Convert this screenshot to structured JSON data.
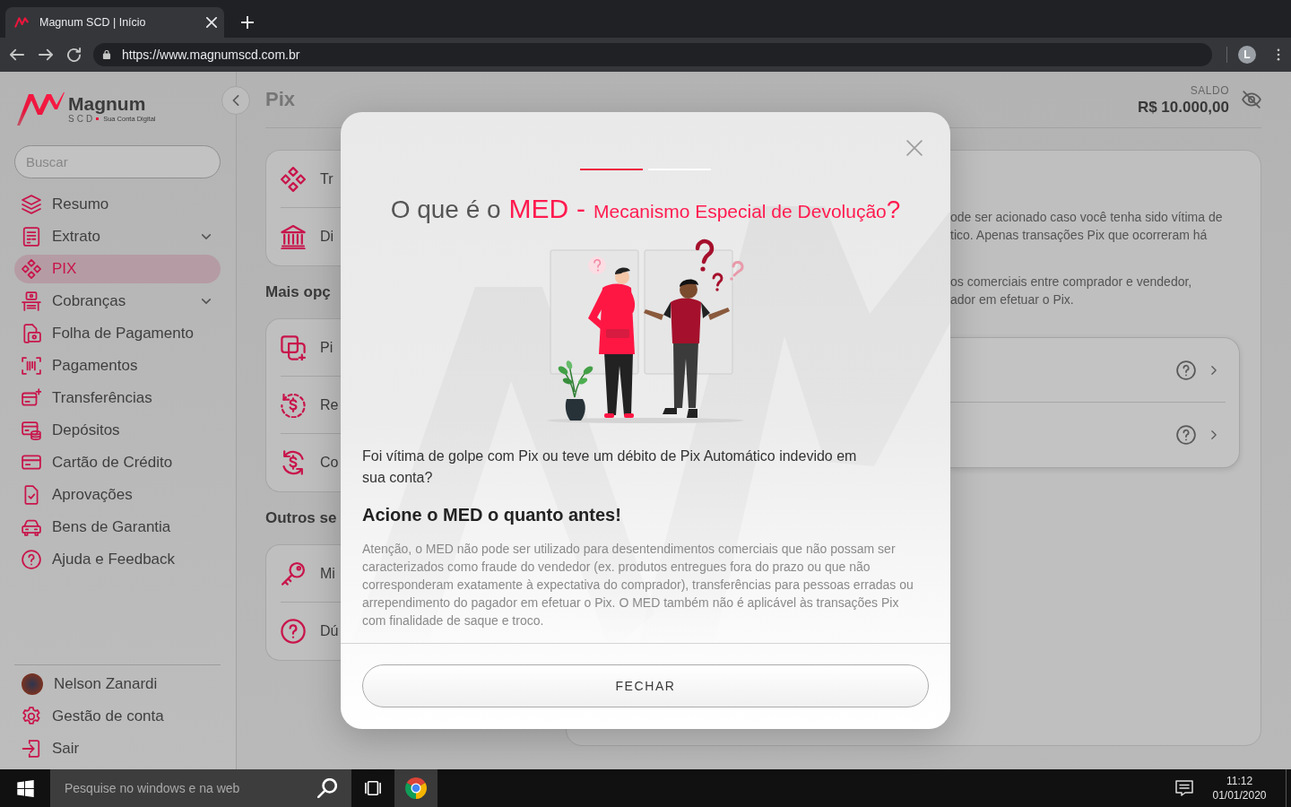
{
  "browser": {
    "tab_title": "Magnum SCD | Início",
    "url": "https://www.magnumscd.com.br",
    "profile_initial": "L"
  },
  "sidebar": {
    "logo": {
      "name": "Magnum",
      "suffix": "SCD",
      "tagline": "Sua Conta Digital"
    },
    "search": {
      "placeholder": "Buscar"
    },
    "items": [
      {
        "label": "Resumo",
        "selected": false,
        "has_submenu": false
      },
      {
        "label": "Extrato",
        "selected": false,
        "has_submenu": true
      },
      {
        "label": "PIX",
        "selected": true,
        "has_submenu": false
      },
      {
        "label": "Cobranças",
        "selected": false,
        "has_submenu": true
      },
      {
        "label": "Folha de Pagamento",
        "selected": false,
        "has_submenu": false
      },
      {
        "label": "Pagamentos",
        "selected": false,
        "has_submenu": false
      },
      {
        "label": "Transferências",
        "selected": false,
        "has_submenu": false
      },
      {
        "label": "Depósitos",
        "selected": false,
        "has_submenu": false
      },
      {
        "label": "Cartão de Crédito",
        "selected": false,
        "has_submenu": false
      },
      {
        "label": "Aprovações",
        "selected": false,
        "has_submenu": false
      },
      {
        "label": "Bens de Garantia",
        "selected": false,
        "has_submenu": false
      },
      {
        "label": "Ajuda e Feedback",
        "selected": false,
        "has_submenu": false
      }
    ],
    "user": {
      "name": "Nelson Zanardi"
    },
    "footer_items": [
      {
        "label": "Gestão de conta"
      },
      {
        "label": "Sair"
      }
    ]
  },
  "main": {
    "title": "Pix",
    "balance": {
      "label": "SALDO",
      "amount": "R$ 10.000,00"
    },
    "left_column": [
      {
        "kind": "card",
        "items": [
          {
            "label": "Tr"
          },
          {
            "label": "Di"
          }
        ]
      },
      {
        "kind": "heading",
        "text": "Mais opç"
      },
      {
        "kind": "card",
        "items": [
          {
            "label": "Pi"
          },
          {
            "label": "Re"
          },
          {
            "label": "Co"
          }
        ]
      },
      {
        "kind": "heading",
        "text": "Outros se"
      },
      {
        "kind": "card",
        "items": [
          {
            "label": "Mi"
          },
          {
            "label": "Dú"
          }
        ]
      }
    ],
    "right_card": {
      "paragraphs": [
        [
          "ode ser acionado caso você tenha sido vítima de",
          "tico. Apenas transações Pix que ocorreram há"
        ],
        [
          "os comerciais entre comprador e vendedor,",
          "ador em efetuar o Pix."
        ]
      ],
      "rows": [
        {
          "help": true
        },
        {
          "help": true
        }
      ]
    }
  },
  "modal": {
    "steps": [
      {
        "selected": true
      },
      {
        "selected": false
      }
    ],
    "title": [
      {
        "kind": "plain",
        "text": "O que é o"
      },
      {
        "kind": "accent",
        "text": "MED"
      },
      {
        "kind": "accent",
        "text": "-"
      },
      {
        "kind": "accent-small",
        "text": "Mecanismo Especial de Devolução"
      },
      {
        "kind": "closing",
        "text": "?"
      }
    ],
    "question": "Foi vítima de golpe com Pix ou teve um débito de Pix Automático indevido em sua conta?",
    "headline": "Acione o MED o quanto antes!",
    "notice": "Atenção, o MED não pode ser utilizado para desentendimentos comerciais que não possam ser caracterizados como fraude do vendedor (ex. produtos entregues fora do prazo ou que não corresponderam exatamente à expectativa do comprador), transferências para pessoas erradas ou arrependimento do pagador em efetuar o Pix. O MED também não é aplicável às transações Pix com finalidade de saque e troco.",
    "close_button": "FECHAR"
  },
  "taskbar": {
    "search_placeholder": "Pesquise no windows e na web",
    "apps": [
      {
        "kind": "browser",
        "active": true
      }
    ],
    "time": "11:12",
    "date": "01/01/2020"
  }
}
